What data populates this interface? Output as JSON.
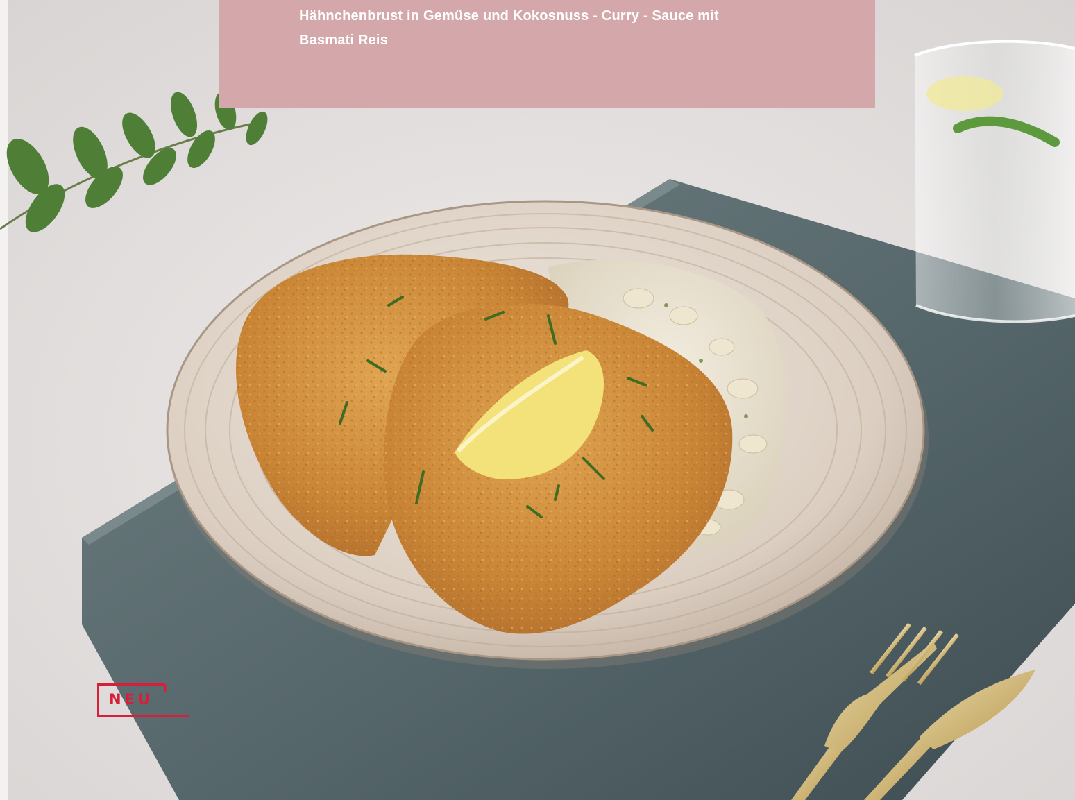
{
  "caption": {
    "line1": "Hähnchenbrust in Gemüse und Kokosnuss - Curry - Sauce mit",
    "line2": "Basmati Reis"
  },
  "badge": {
    "label": "NEU"
  },
  "colors": {
    "caption_bg": "#d4a8aa",
    "caption_text": "#ffffff",
    "badge_red": "#d6203a",
    "background": "#e7e4e3",
    "slate": "#55666a",
    "plate": "#d9cdc1",
    "schnitzel": "#c98535",
    "lemon": "#f3e27a"
  },
  "icons": {
    "badge_icon": "new-badge-outline",
    "photo": "schnitzel-plate-photo"
  }
}
